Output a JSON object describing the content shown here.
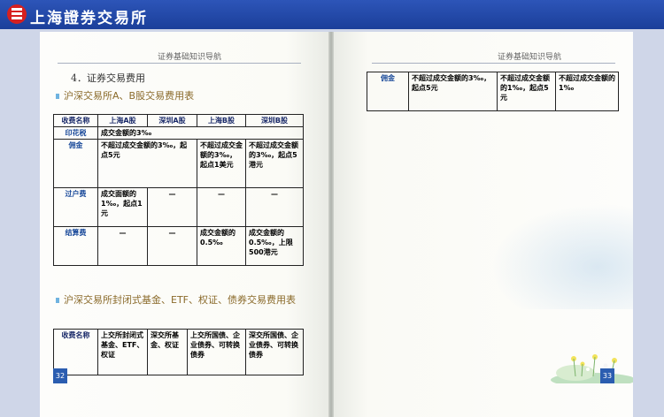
{
  "brand": {
    "title": "上海證券交易所"
  },
  "header": {
    "left": "证券基础知识导航",
    "right": "证券基础知识导航"
  },
  "left_page": {
    "section": "4．证券交易费用",
    "sub1": "沪深交易所A、B股交易费用表",
    "table1": {
      "headers": [
        "收费名称",
        "上海A股",
        "深圳A股",
        "上海B股",
        "深圳B股"
      ],
      "yinhua": {
        "label": "印花税",
        "value": "成交金额的3‰"
      },
      "yongjin": {
        "label": "佣金",
        "a": "不超过成交金额的3‰，起点5元",
        "shb": "不超过成交金额的3‰，起点1美元",
        "szb": "不超过成交金额的3‰，起点5港元"
      },
      "guohu": {
        "label": "过户费",
        "sha": "成交面额的1‰，起点1元",
        "sza": "—",
        "shb": "—",
        "szb": "—"
      },
      "jiesuan": {
        "label": "结算费",
        "sha": "—",
        "sza": "—",
        "shb": "成交金额的0.5‰",
        "szb": "成交金额的0.5‰，上限500港元"
      }
    },
    "sub2": "沪深交易所封闭式基金、ETF、权证、债券交易费用表",
    "table2": {
      "headers": [
        "收费名称",
        "上交所封闭式基金、ETF、权证",
        "深交所基金、权证",
        "上交所国债、企业债券、可转换债券",
        "深交所国债、企业债券、可转换债券"
      ]
    },
    "page_number": "32"
  },
  "right_page": {
    "table": {
      "label": "佣金",
      "c1": "不超过成交金额的3‰，起点5元",
      "c2": "不超过成交金额的1‰，起点5元",
      "c3": "不超过成交金额的1‰"
    },
    "page_number": "33"
  }
}
